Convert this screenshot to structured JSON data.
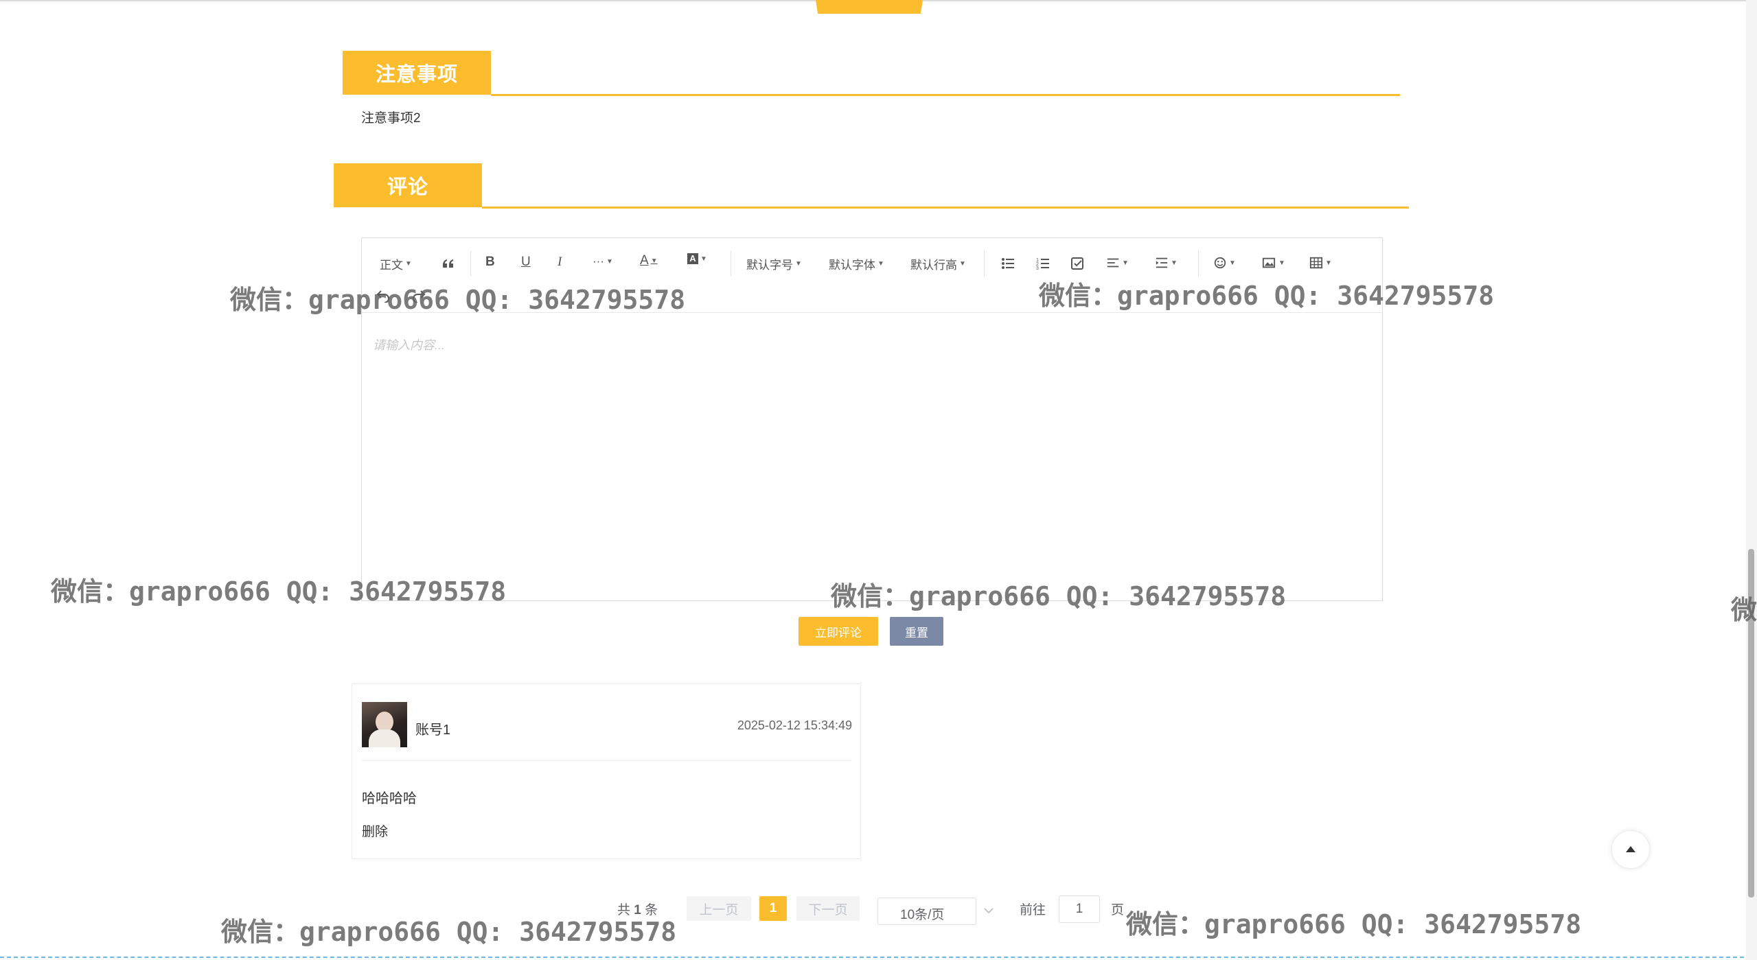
{
  "notice": {
    "title": "注意事项",
    "content": "注意事项2"
  },
  "comment": {
    "title": "评论",
    "editor": {
      "placeholder": "请输入内容...",
      "toolbar": {
        "paragraph": "正文",
        "font_size": "默认字号",
        "font_family": "默认字体",
        "line_height": "默认行高",
        "more": "···"
      }
    },
    "submit_label": "立即评论",
    "reset_label": "重置"
  },
  "comments": [
    {
      "username": "账号1",
      "time": "2025-02-12 15:34:49",
      "content": "哈哈哈哈",
      "delete_label": "删除"
    }
  ],
  "pagination": {
    "total_prefix": "共",
    "total": "1",
    "total_suffix": "条",
    "prev_label": "上一页",
    "current_page": "1",
    "next_label": "下一页",
    "page_size": "10条/页",
    "goto_label": "前往",
    "goto_value": "1",
    "page_suffix": "页"
  },
  "watermarks": {
    "w1": "微信：grapro666 QQ: 3642795578",
    "w2": "微信：grapro666 QQ: 3642795578",
    "w3": "微信：grapro666 QQ: 3642795578",
    "w4": "微信：grapro666 QQ: 3642795578",
    "w5": "微信：grapro666 QQ: 3642795578",
    "w6": "微信：grapro666 QQ: 3642795578",
    "w7": "微"
  },
  "colors": {
    "accent": "#fbbd2d",
    "reset_button": "#7b88a6"
  },
  "icons": [
    "quote-icon",
    "bold-icon",
    "underline-icon",
    "italic-icon",
    "font-color-icon",
    "background-color-icon",
    "bullet-list-icon",
    "numbered-list-icon",
    "todo-icon",
    "align-icon",
    "indent-icon",
    "emoji-icon",
    "image-icon",
    "table-icon",
    "undo-icon",
    "redo-icon",
    "back-to-top-icon"
  ]
}
